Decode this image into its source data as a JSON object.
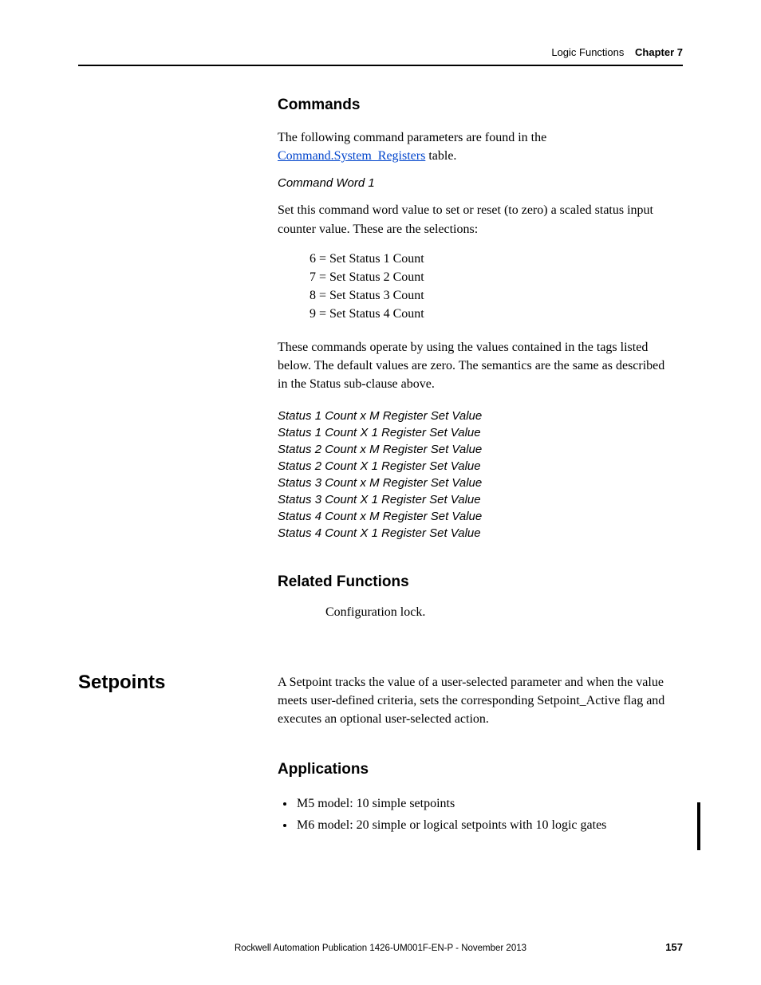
{
  "header": {
    "breadcrumb": "Logic Functions",
    "chapter": "Chapter 7"
  },
  "commands": {
    "heading": "Commands",
    "intro_prefix": "The following command parameters are found in the ",
    "intro_link": "Command.System_Registers",
    "intro_suffix": " table.",
    "sub1_heading": "Command Word 1",
    "sub1_body": "Set this command word value to set or reset (to zero) a scaled status input counter value. These are the selections:",
    "selections": [
      "6 = Set Status 1 Count",
      "7 = Set Status 2 Count",
      "8 = Set Status 3 Count",
      "9 = Set Status 4 Count"
    ],
    "after_selections": "These commands operate by using the values contained in the tags listed below. The default values are zero. The semantics are the same as described in the Status sub-clause above.",
    "register_list": [
      "Status 1 Count x M Register Set Value",
      "Status 1 Count X 1 Register Set Value",
      "Status 2 Count x M Register Set Value",
      "Status 2 Count X 1 Register Set Value",
      "Status 3 Count x M Register Set Value",
      "Status 3 Count X 1 Register Set Value",
      "Status 4 Count x M Register Set Value",
      "Status 4 Count X 1 Register Set Value"
    ]
  },
  "related": {
    "heading": "Related Functions",
    "body": "Configuration lock."
  },
  "setpoints": {
    "side_heading": "Setpoints",
    "body": "A Setpoint tracks the value of a user-selected parameter and when the value meets user-defined criteria, sets the corresponding Setpoint_Active flag and executes an optional user-selected action."
  },
  "applications": {
    "heading": "Applications",
    "items": [
      "M5 model: 10 simple setpoints",
      "M6 model: 20 simple or logical setpoints with 10 logic gates"
    ]
  },
  "footer": {
    "publication": "Rockwell Automation Publication 1426-UM001F-EN-P - November 2013",
    "page": "157"
  }
}
